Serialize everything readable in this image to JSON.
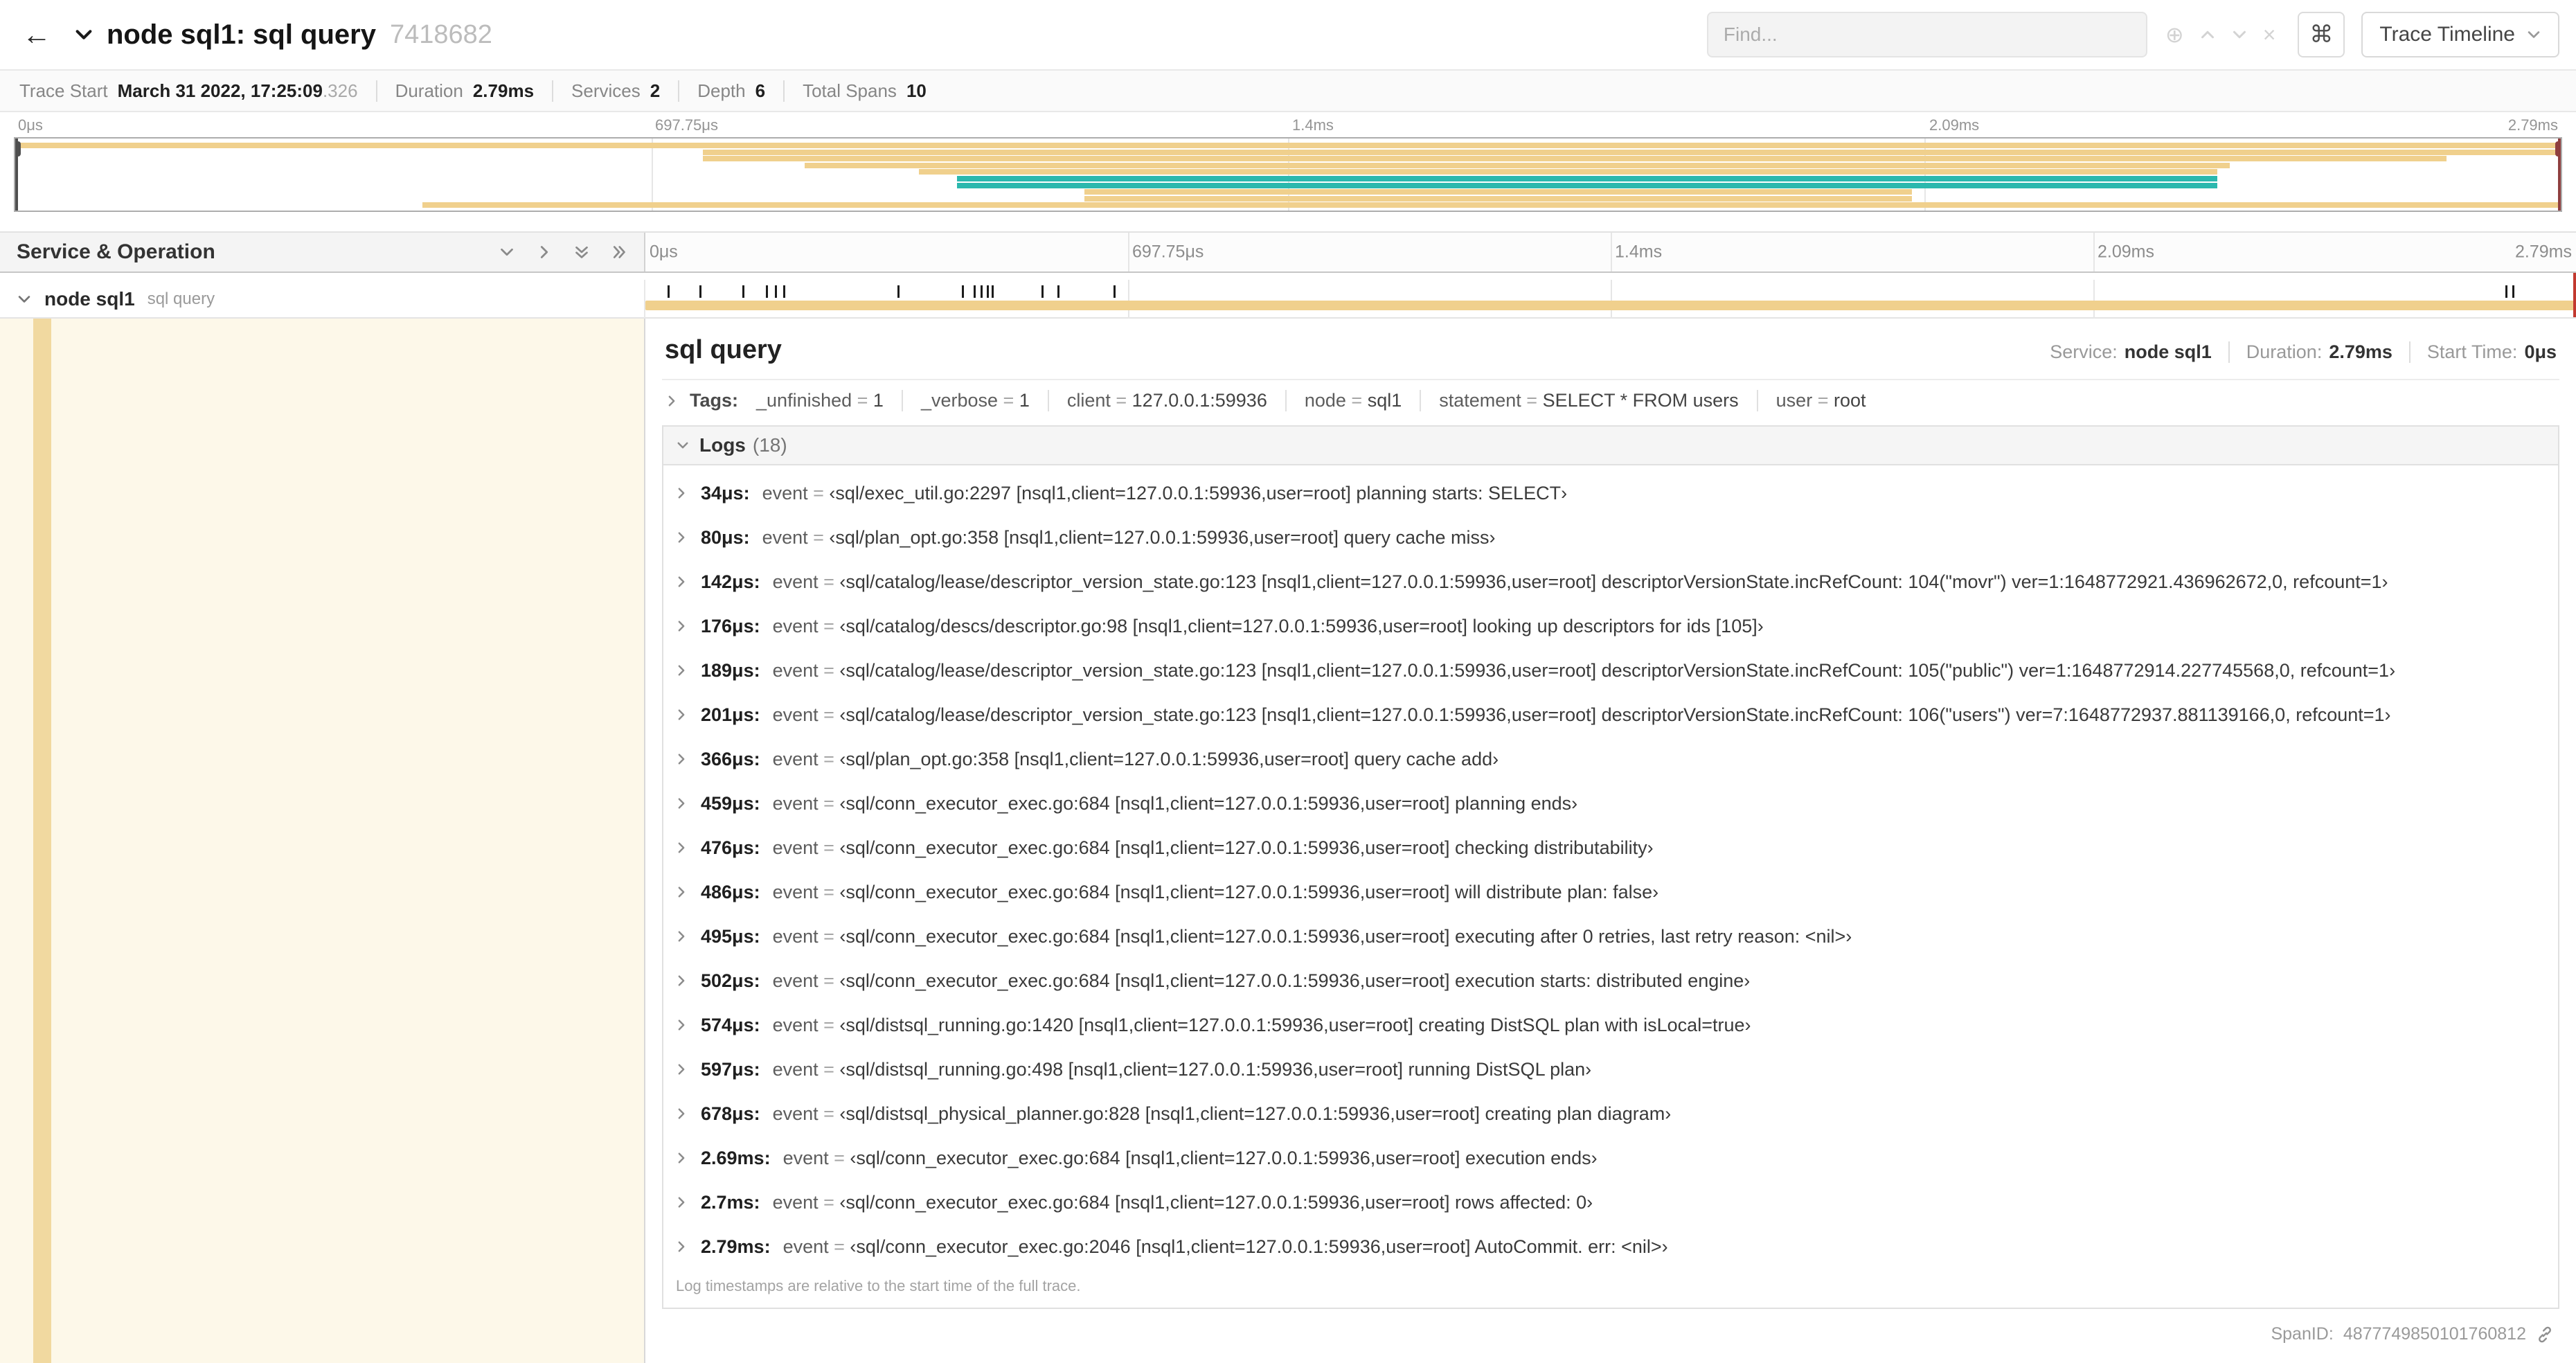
{
  "colors": {
    "span_tan": "#f0d08d",
    "span_teal": "#2bb8ae",
    "detail_bg": "#fdf8e9",
    "detail_strip": "#f1d9a0"
  },
  "header": {
    "title": "node sql1: sql query",
    "trace_id": "7418682",
    "find_placeholder": "Find...",
    "shortcuts_key": "⌘",
    "view_options_label": "Trace Timeline"
  },
  "summary": {
    "items": [
      {
        "label": "Trace Start",
        "value": "March 31 2022, 17:25:09",
        "suffix": ".326"
      },
      {
        "label": "Duration",
        "value": "2.79ms"
      },
      {
        "label": "Services",
        "value": "2"
      },
      {
        "label": "Depth",
        "value": "6"
      },
      {
        "label": "Total Spans",
        "value": "10"
      }
    ]
  },
  "timeline": {
    "duration_us": 2790,
    "ticks": [
      "0μs",
      "697.75μs",
      "1.4ms",
      "2.09ms",
      "2.79ms"
    ],
    "tick_pcts": [
      0,
      25,
      50,
      75,
      100
    ],
    "left_header": "Service & Operation",
    "row": {
      "service": "node sql1",
      "operation": "sql query",
      "start_pct": 0,
      "end_pct": 100
    }
  },
  "minimap": {
    "spans": [
      {
        "start": 0,
        "end": 100,
        "color": "span_tan"
      },
      {
        "start": 27,
        "end": 100,
        "color": "span_tan"
      },
      {
        "start": 27,
        "end": 95.5,
        "color": "span_tan"
      },
      {
        "start": 31,
        "end": 87,
        "color": "span_tan"
      },
      {
        "start": 35.5,
        "end": 86.5,
        "color": "span_tan"
      },
      {
        "start": 37,
        "end": 86.5,
        "color": "span_teal"
      },
      {
        "start": 37,
        "end": 86.5,
        "color": "span_teal"
      },
      {
        "start": 42,
        "end": 74.5,
        "color": "span_tan"
      },
      {
        "start": 42,
        "end": 74.5,
        "color": "span_tan"
      },
      {
        "start": 16,
        "end": 100,
        "color": "span_tan"
      }
    ]
  },
  "detail": {
    "operation": "sql query",
    "service_label": "Service:",
    "service_value": "node sql1",
    "duration_label": "Duration:",
    "duration_value": "2.79ms",
    "start_label": "Start Time:",
    "start_value": "0μs",
    "tags_label": "Tags:",
    "tags": [
      {
        "key": "_unfinished",
        "value": "1"
      },
      {
        "key": "_verbose",
        "value": "1"
      },
      {
        "key": "client",
        "value": "127.0.0.1:59936"
      },
      {
        "key": "node",
        "value": "sql1"
      },
      {
        "key": "statement",
        "value": "SELECT * FROM users"
      },
      {
        "key": "user",
        "value": "root"
      }
    ],
    "logs_label": "Logs",
    "logs_count": "(18)",
    "logs_note": "Log timestamps are relative to the start time of the full trace.",
    "span_id_label": "SpanID:",
    "span_id_value": "4877749850101760812",
    "logs": [
      {
        "time": "34μs:",
        "t_us": 34,
        "key": "event",
        "value": "‹sql/exec_util.go:2297 [nsql1,client=127.0.0.1:59936,user=root] planning starts: SELECT›"
      },
      {
        "time": "80μs:",
        "t_us": 80,
        "key": "event",
        "value": "‹sql/plan_opt.go:358 [nsql1,client=127.0.0.1:59936,user=root] query cache miss›"
      },
      {
        "time": "142μs:",
        "t_us": 142,
        "key": "event",
        "value": "‹sql/catalog/lease/descriptor_version_state.go:123 [nsql1,client=127.0.0.1:59936,user=root] descriptorVersionState.incRefCount: 104(\"movr\") ver=1:1648772921.436962672,0, refcount=1›"
      },
      {
        "time": "176μs:",
        "t_us": 176,
        "key": "event",
        "value": "‹sql/catalog/descs/descriptor.go:98 [nsql1,client=127.0.0.1:59936,user=root] looking up descriptors for ids [105]›"
      },
      {
        "time": "189μs:",
        "t_us": 189,
        "key": "event",
        "value": "‹sql/catalog/lease/descriptor_version_state.go:123 [nsql1,client=127.0.0.1:59936,user=root] descriptorVersionState.incRefCount: 105(\"public\") ver=1:1648772914.227745568,0, refcount=1›"
      },
      {
        "time": "201μs:",
        "t_us": 201,
        "key": "event",
        "value": "‹sql/catalog/lease/descriptor_version_state.go:123 [nsql1,client=127.0.0.1:59936,user=root] descriptorVersionState.incRefCount: 106(\"users\") ver=7:1648772937.881139166,0, refcount=1›"
      },
      {
        "time": "366μs:",
        "t_us": 366,
        "key": "event",
        "value": "‹sql/plan_opt.go:358 [nsql1,client=127.0.0.1:59936,user=root] query cache add›"
      },
      {
        "time": "459μs:",
        "t_us": 459,
        "key": "event",
        "value": "‹sql/conn_executor_exec.go:684 [nsql1,client=127.0.0.1:59936,user=root] planning ends›"
      },
      {
        "time": "476μs:",
        "t_us": 476,
        "key": "event",
        "value": "‹sql/conn_executor_exec.go:684 [nsql1,client=127.0.0.1:59936,user=root] checking distributability›"
      },
      {
        "time": "486μs:",
        "t_us": 486,
        "key": "event",
        "value": "‹sql/conn_executor_exec.go:684 [nsql1,client=127.0.0.1:59936,user=root] will distribute plan: false›"
      },
      {
        "time": "495μs:",
        "t_us": 495,
        "key": "event",
        "value": "‹sql/conn_executor_exec.go:684 [nsql1,client=127.0.0.1:59936,user=root] executing after 0 retries, last retry reason: <nil>›"
      },
      {
        "time": "502μs:",
        "t_us": 502,
        "key": "event",
        "value": "‹sql/conn_executor_exec.go:684 [nsql1,client=127.0.0.1:59936,user=root] execution starts: distributed engine›"
      },
      {
        "time": "574μs:",
        "t_us": 574,
        "key": "event",
        "value": "‹sql/distsql_running.go:1420 [nsql1,client=127.0.0.1:59936,user=root] creating DistSQL plan with isLocal=true›"
      },
      {
        "time": "597μs:",
        "t_us": 597,
        "key": "event",
        "value": "‹sql/distsql_running.go:498 [nsql1,client=127.0.0.1:59936,user=root] running DistSQL plan›"
      },
      {
        "time": "678μs:",
        "t_us": 678,
        "key": "event",
        "value": "‹sql/distsql_physical_planner.go:828 [nsql1,client=127.0.0.1:59936,user=root] creating plan diagram›"
      },
      {
        "time": "2.69ms:",
        "t_us": 2690,
        "key": "event",
        "value": "‹sql/conn_executor_exec.go:684 [nsql1,client=127.0.0.1:59936,user=root] execution ends›"
      },
      {
        "time": "2.7ms:",
        "t_us": 2700,
        "key": "event",
        "value": "‹sql/conn_executor_exec.go:684 [nsql1,client=127.0.0.1:59936,user=root] rows affected: 0›"
      },
      {
        "time": "2.79ms:",
        "t_us": 2790,
        "key": "event",
        "value": "‹sql/conn_executor_exec.go:2046 [nsql1,client=127.0.0.1:59936,user=root] AutoCommit. err: <nil>›"
      }
    ]
  }
}
